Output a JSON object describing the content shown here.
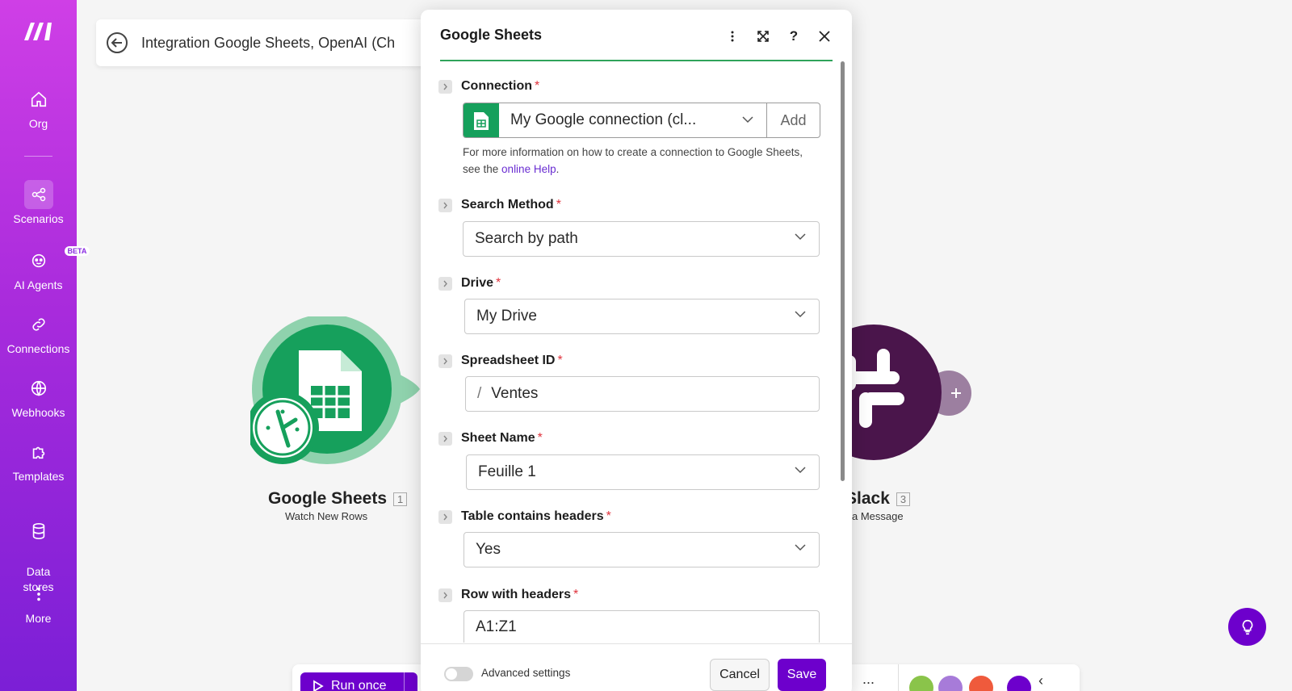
{
  "sidebar": {
    "items": [
      {
        "label": "Org",
        "icon": "home-icon"
      },
      {
        "label": "Scenarios",
        "icon": "share-icon"
      },
      {
        "label": "AI Agents",
        "icon": "ai-agent-icon",
        "badge": "BETA"
      },
      {
        "label": "Connections",
        "icon": "link-icon"
      },
      {
        "label": "Webhooks",
        "icon": "globe-icon"
      },
      {
        "label": "Templates",
        "icon": "puzzle-icon"
      },
      {
        "label": "Data\nstores",
        "icon": "database-icon"
      },
      {
        "label": "More",
        "icon": "more-vertical-icon"
      }
    ]
  },
  "topbar": {
    "title": "Integration Google Sheets, OpenAI (Ch"
  },
  "canvas": {
    "modules": [
      {
        "name": "Google Sheets",
        "number": "1",
        "subtitle": "Watch New Rows"
      },
      {
        "name": "Slack",
        "number": "3",
        "subtitle": "a Message"
      }
    ]
  },
  "toolbar": {
    "run_label": "Run once",
    "more": "..."
  },
  "modal": {
    "title": "Google Sheets",
    "connection": {
      "label": "Connection",
      "value": "My Google connection (cl...",
      "add_label": "Add",
      "help_prefix": "For more information on how to create a connection to Google Sheets, see the ",
      "help_link": "online Help",
      "help_suffix": "."
    },
    "search_method": {
      "label": "Search Method",
      "value": "Search by path"
    },
    "drive": {
      "label": "Drive",
      "value": "My Drive"
    },
    "spreadsheet_id": {
      "label": "Spreadsheet ID",
      "value": "Ventes",
      "prefix": "/"
    },
    "sheet_name": {
      "label": "Sheet Name",
      "value": "Feuille 1"
    },
    "table_headers": {
      "label": "Table contains headers",
      "value": "Yes"
    },
    "row_headers": {
      "label": "Row with headers",
      "value": "A1:Z1"
    },
    "footer": {
      "advanced_label": "Advanced settings",
      "cancel_label": "Cancel",
      "save_label": "Save"
    }
  },
  "colors": {
    "brand": "#6d00cc",
    "sheets_green": "#16a05c",
    "slack": "#4a154b",
    "required": "#e0333d"
  }
}
